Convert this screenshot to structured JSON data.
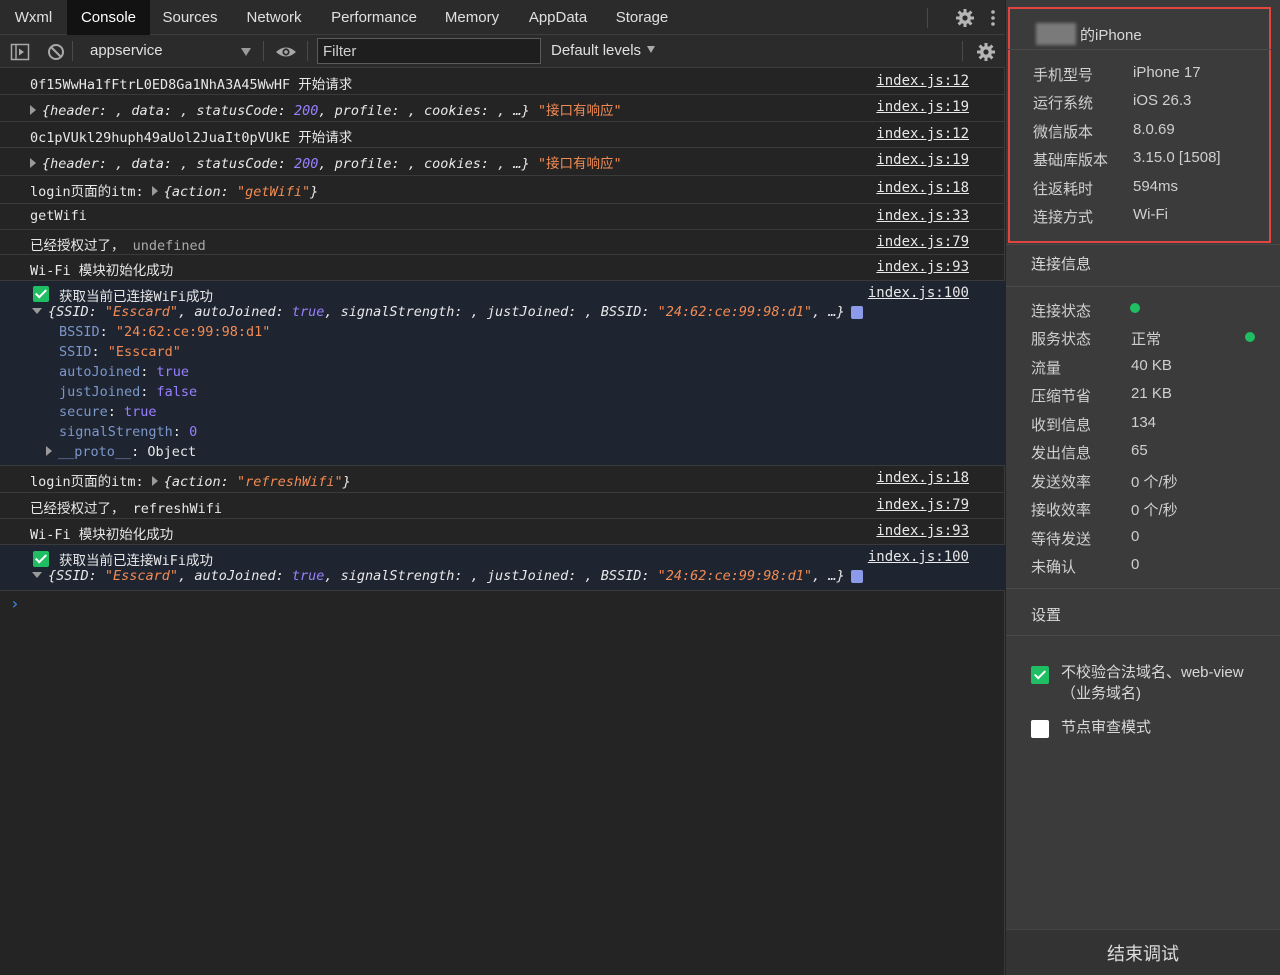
{
  "tabs": [
    "Wxml",
    "Console",
    "Sources",
    "Network",
    "Performance",
    "Memory",
    "AppData",
    "Storage"
  ],
  "active_tab": "Console",
  "toolbar": {
    "context": "appservice",
    "filter_placeholder": "Filter",
    "levels": "Default levels"
  },
  "console": {
    "r1": {
      "msg": "0f15WwHa1fFtrL0ED8Ga1NhA3A45WwHF 开始请求",
      "src": "index.js:12"
    },
    "r2": {
      "pre": "{header: , data: , statusCode: ",
      "num": "200",
      "post": ", profile: , cookies: , …}",
      "str": "\"接口有响应\"",
      "src": "index.js:19"
    },
    "r3": {
      "msg": "0c1pVUkl29huph49aUol2JuaIt0pVUkE 开始请求",
      "src": "index.js:12"
    },
    "r4": {
      "pre": "{header: , data: , statusCode: ",
      "num": "200",
      "post": ", profile: , cookies: , …}",
      "str": "\"接口有响应\"",
      "src": "index.js:19"
    },
    "r5": {
      "label": "login页面的itm: ",
      "obj_pre": "{action: ",
      "obj_str": "\"getWifi\"",
      "obj_post": "}",
      "src": "index.js:18"
    },
    "r6": {
      "msg": "getWifi",
      "src": "index.js:33"
    },
    "r7": {
      "msg": "已经授权过了， ",
      "extra": "undefined",
      "src": "index.js:79"
    },
    "r8": {
      "msg": "Wi-Fi 模块初始化成功",
      "src": "index.js:93"
    },
    "r9": {
      "msg": "获取当前已连接WiFi成功",
      "src": "index.js:100",
      "summary_a": "{SSID: ",
      "summary_b": "\"Esscard\"",
      "summary_c": ", autoJoined: ",
      "summary_d": "true",
      "summary_e": ", signalStrength: , justJoined: , BSSID: ",
      "summary_f": "\"24:62:ce:99:98:d1\"",
      "summary_g": ", …}",
      "props": [
        {
          "k": "BSSID",
          "v": "\"24:62:ce:99:98:d1\"",
          "t": "str"
        },
        {
          "k": "SSID",
          "v": "\"Esscard\"",
          "t": "str"
        },
        {
          "k": "autoJoined",
          "v": "true",
          "t": "kw"
        },
        {
          "k": "justJoined",
          "v": "false",
          "t": "kw"
        },
        {
          "k": "secure",
          "v": "true",
          "t": "kw"
        },
        {
          "k": "signalStrength",
          "v": "0",
          "t": "kw"
        }
      ],
      "proto_k": "__proto__",
      "proto_v": "Object"
    },
    "r10": {
      "label": "login页面的itm: ",
      "obj_pre": "{action: ",
      "obj_str": "\"refreshWifi\"",
      "obj_post": "}",
      "src": "index.js:18"
    },
    "r11": {
      "msg": "已经授权过了， refreshWifi",
      "src": "index.js:79"
    },
    "r12": {
      "msg": "Wi-Fi 模块初始化成功",
      "src": "index.js:93"
    },
    "r13": {
      "msg": "获取当前已连接WiFi成功",
      "src": "index.js:100",
      "summary_a": "{SSID: ",
      "summary_b": "\"Esscard\"",
      "summary_c": ", autoJoined: ",
      "summary_d": "true",
      "summary_e": ", signalStrength: , justJoined: , BSSID: ",
      "summary_f": "\"24:62:ce:99:98:d1\"",
      "summary_g": ", …}"
    },
    "prompt": "›"
  },
  "panel": {
    "device_name": "的iPhone",
    "device_info": [
      {
        "label": "手机型号",
        "value": "iPhone 17"
      },
      {
        "label": "运行系统",
        "value": "iOS 26.3"
      },
      {
        "label": "微信版本",
        "value": "8.0.69"
      },
      {
        "label": "基础库版本",
        "value": "3.15.0 [1508]"
      },
      {
        "label": "往返耗时",
        "value": "594ms"
      },
      {
        "label": "连接方式",
        "value": "Wi-Fi"
      }
    ],
    "connection_title": "连接信息",
    "connection": [
      {
        "label": "连接状态",
        "value": ""
      },
      {
        "label": "服务状态",
        "value": "正常"
      },
      {
        "label": "流量",
        "value": "40 KB"
      },
      {
        "label": "压缩节省",
        "value": "21 KB"
      },
      {
        "label": "收到信息",
        "value": "134"
      },
      {
        "label": "发出信息",
        "value": "65"
      },
      {
        "label": "发送效率",
        "value": "0 个/秒"
      },
      {
        "label": "接收效率",
        "value": "0 个/秒"
      },
      {
        "label": "等待发送",
        "value": "0"
      },
      {
        "label": "未确认",
        "value": "0"
      }
    ],
    "settings_title": "设置",
    "settings": [
      {
        "label": "不校验合法域名、web-view（业务域名)",
        "checked": true
      },
      {
        "label": "节点审查模式",
        "checked": false
      }
    ],
    "end_button": "结束调试"
  },
  "colors": {
    "accent_green": "#1fbe62",
    "highlight_red": "#e0453f",
    "string": "#f28b54",
    "keyword": "#9980ff"
  }
}
